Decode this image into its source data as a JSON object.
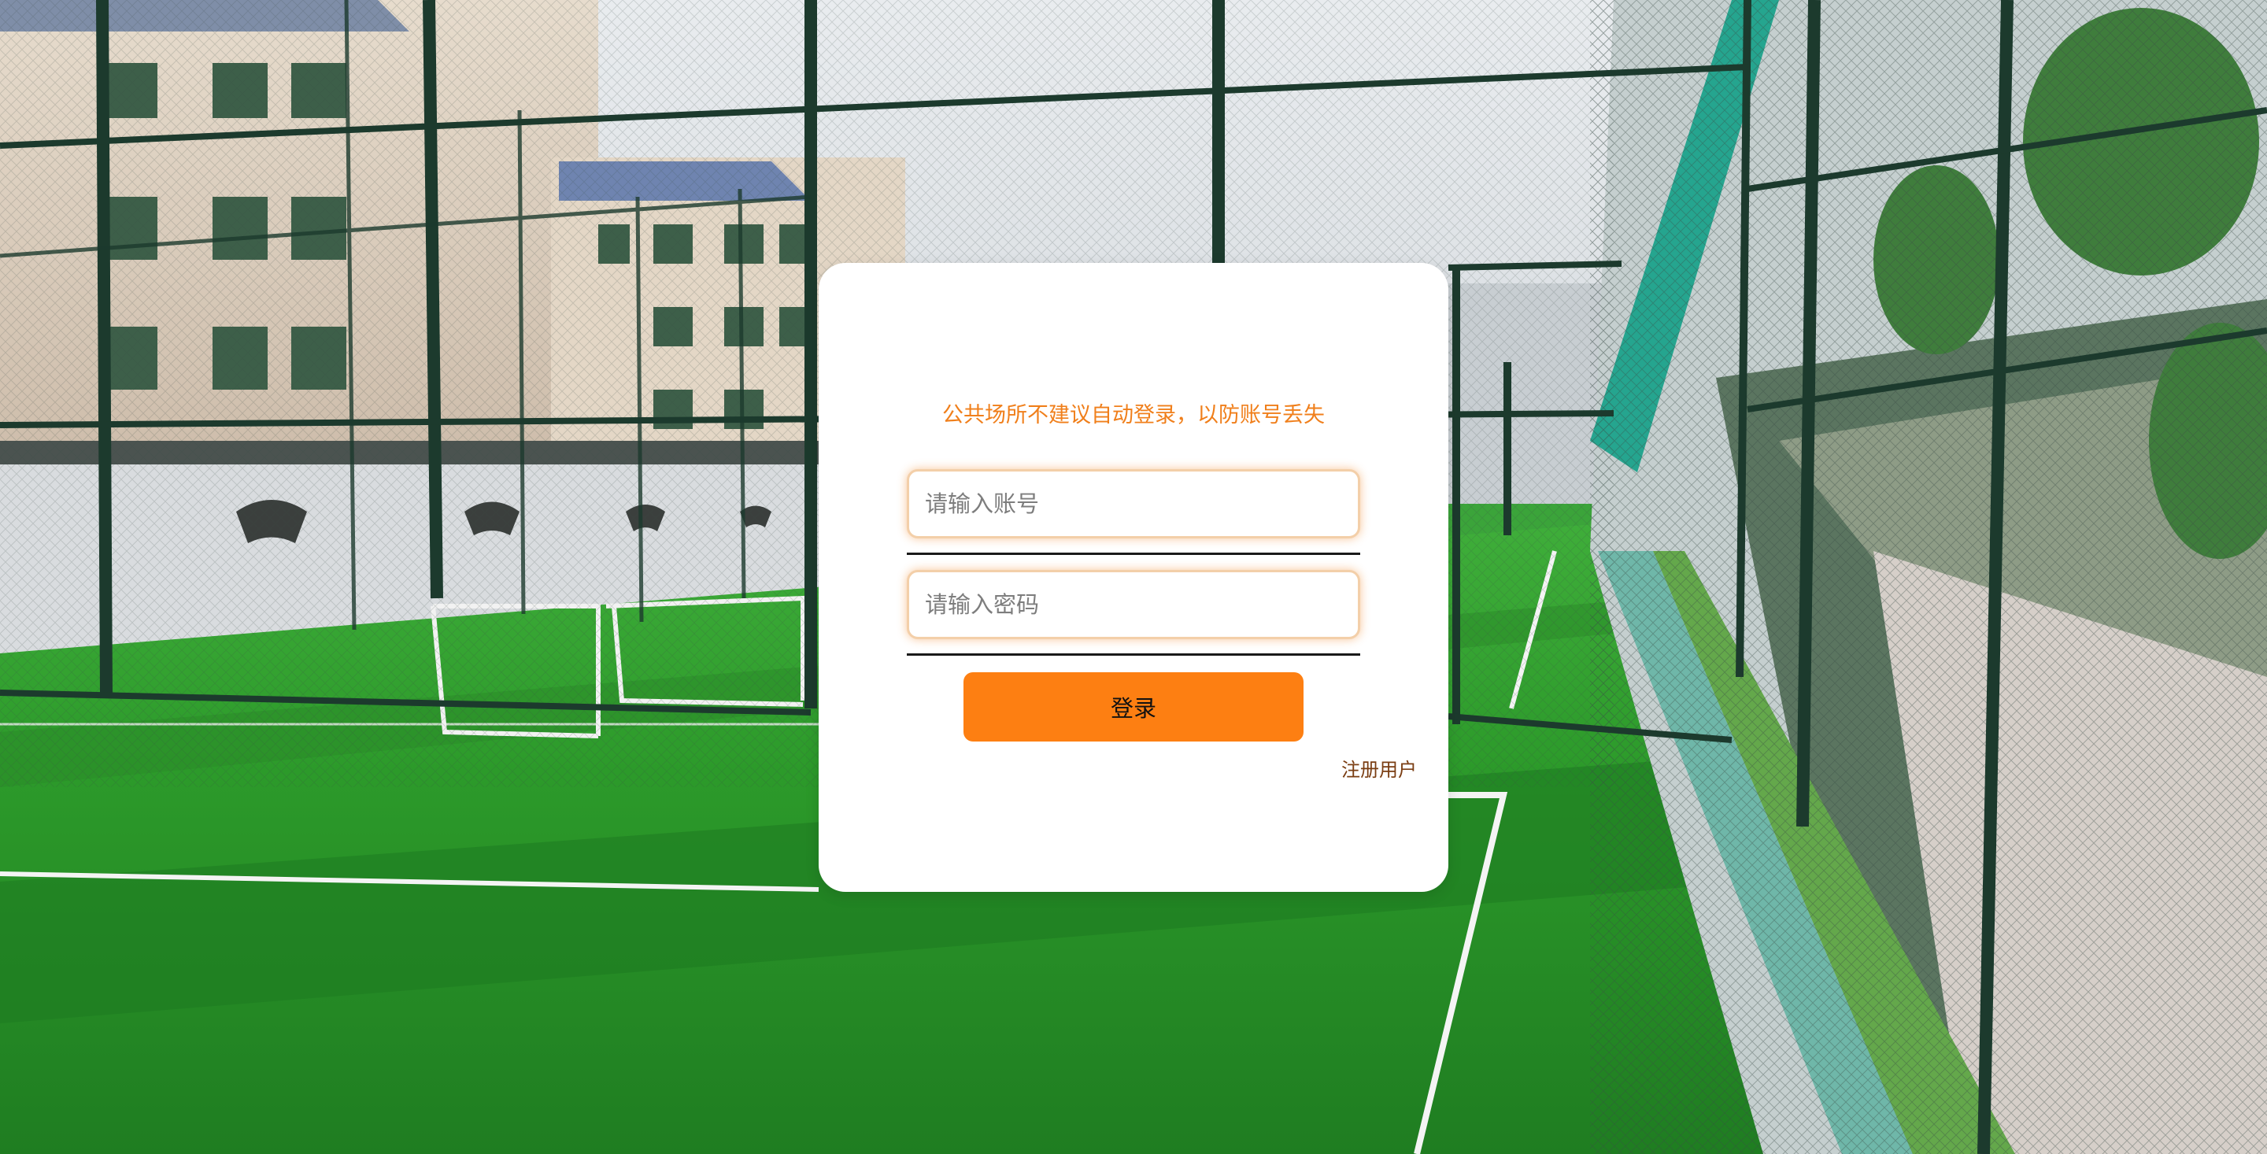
{
  "login": {
    "notice": "公共场所不建议自动登录，以防账号丢失",
    "account_placeholder": "请输入账号",
    "account_value": "",
    "password_placeholder": "请输入密码",
    "password_value": "",
    "login_label": "登录",
    "register_label": "注册用户"
  },
  "colors": {
    "accent": "#fd7f12",
    "notice": "#f07f1b",
    "register_link": "#7a3d12",
    "card": "#ffffff"
  },
  "background": {
    "description_icon": "soccer-field-photo"
  }
}
